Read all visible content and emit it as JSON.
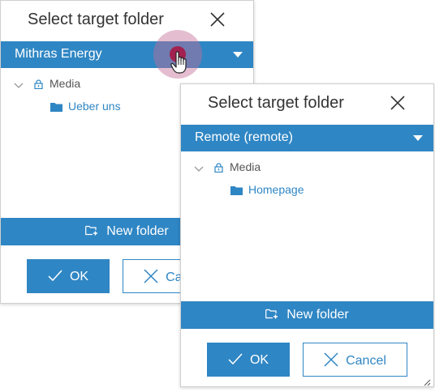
{
  "back_dialog": {
    "title": "Select target folder",
    "space": "Mithras Energy",
    "tree": {
      "root": "Media",
      "children": [
        "Ueber uns"
      ]
    },
    "new_folder": "New folder",
    "ok": "OK",
    "cancel": "Cancel"
  },
  "front_dialog": {
    "title": "Select target folder",
    "space": "Remote (remote)",
    "tree": {
      "root": "Media",
      "children": [
        "Homepage"
      ]
    },
    "new_folder": "New folder",
    "ok": "OK",
    "cancel": "Cancel"
  },
  "colors": {
    "accent": "#2f86c4",
    "click_indicator": "#a3214f"
  },
  "icons": {
    "close": "close-icon",
    "dropdown": "chevron-down-icon",
    "tree_toggle": "chevron-down-icon",
    "root": "lock-icon",
    "folder": "folder-icon",
    "new_folder": "new-folder-icon",
    "ok": "checkmark-icon",
    "cancel": "close-icon",
    "cursor": "hand-pointer-icon"
  }
}
